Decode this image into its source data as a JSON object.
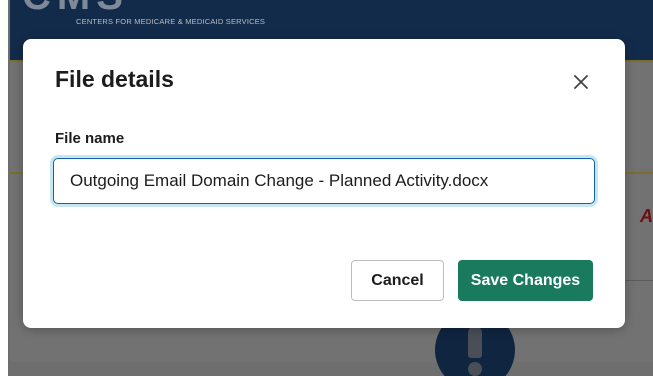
{
  "background": {
    "logo_mark": "CMS",
    "logo_text": "CENTERS FOR MEDICARE & MEDICAID SERVICES",
    "partial_text": "A"
  },
  "modal": {
    "title": "File details",
    "close_icon": "close-icon",
    "field_label": "File name",
    "file_name_value": "Outgoing Email Domain Change - Planned Activity.docx",
    "cancel_label": "Cancel",
    "save_label": "Save Changes"
  },
  "colors": {
    "save_button_bg": "#1a7a5e",
    "input_focus_border": "#1264a3",
    "header_bg": "#132b4a"
  }
}
